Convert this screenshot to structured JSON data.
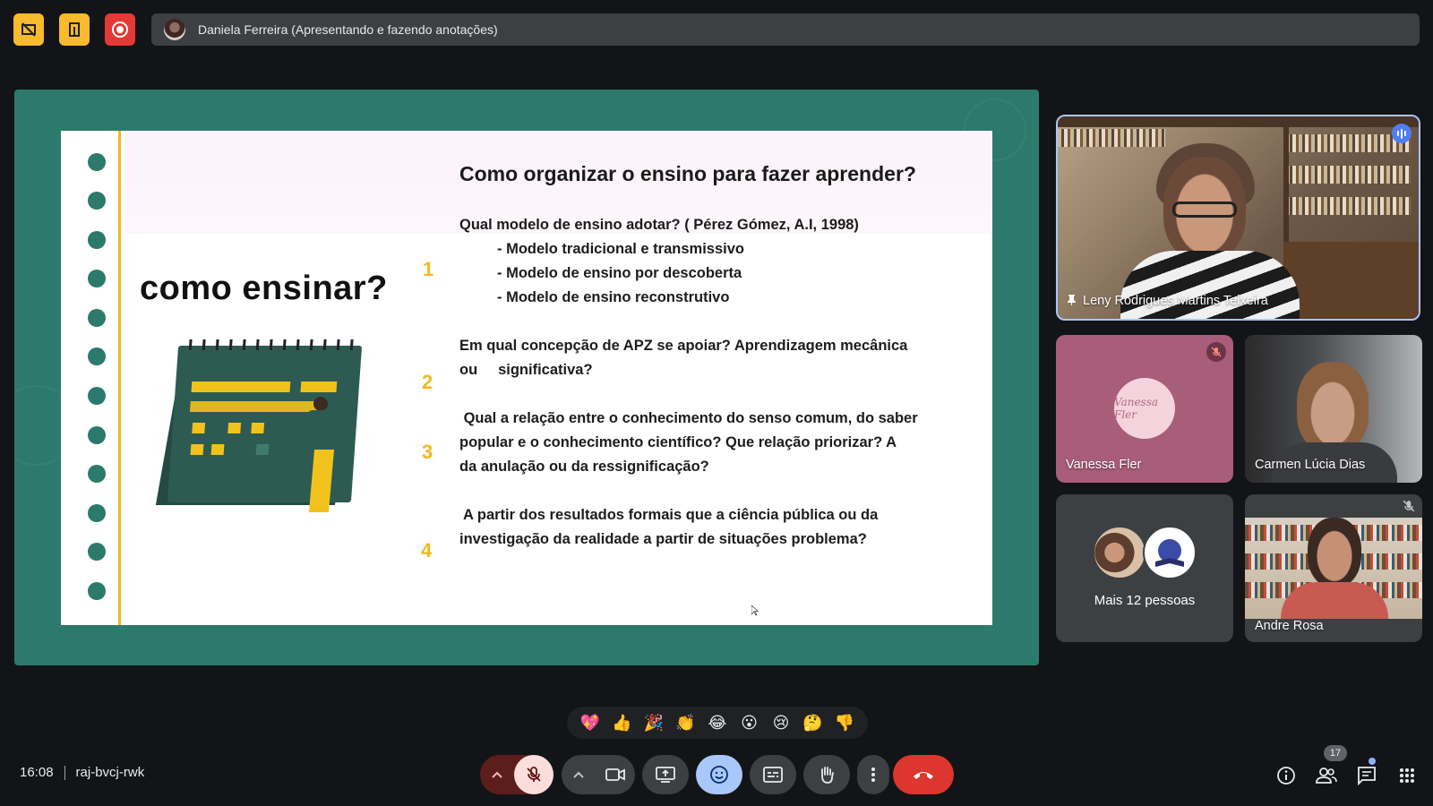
{
  "presenter": {
    "label": "Daniela Ferreira (Apresentando e fazendo anotações)"
  },
  "slide": {
    "title": "Como organizar o ensino para fazer aprender?",
    "heading": "como ensinar?",
    "q1": "Qual modelo de ensino adotar? ( Pérez Gómez, A.I, 1998)",
    "q1_items": [
      "- Modelo tradicional e transmissivo",
      "- Modelo de ensino por descoberta",
      "- Modelo de ensino reconstrutivo"
    ],
    "q2_line1": "Em qual concepção de APZ se apoiar? Aprendizagem mecânica",
    "q2_line2": "ou     significativa?",
    "q3_line1": " Qual a relação entre o conhecimento do senso comum, do saber",
    "q3_line2": "popular e o conhecimento científico? Que relação priorizar? A",
    "q3_line3": "da anulação ou da ressignificação?",
    "q4_line1": " A partir dos resultados formais que a ciência pública ou da",
    "q4_line2": "investigação da realidade a partir de situações problema?",
    "numbers": [
      "1",
      "2",
      "3",
      "4"
    ]
  },
  "participants": {
    "main": "Leny Rodrigues Martins Teixeira",
    "vanessa": "Vanessa Fler",
    "vanessa_logo": "Vanessa Fler",
    "carmen": "Carmen Lúcia Dias",
    "more": "Mais 12 pessoas",
    "andre": "Andre Rosa"
  },
  "reactions": [
    "💖",
    "👍",
    "🎉",
    "👏",
    "😂",
    "😮",
    "😢",
    "🤔",
    "👎"
  ],
  "meeting": {
    "time": "16:08",
    "code": "raj-bvcj-rwk",
    "people_count": "17"
  },
  "colors": {
    "accent_yellow": "#f9bb2d",
    "record_red": "#e53935",
    "end_call_red": "#dc362e",
    "active_blue": "#a8c7fa",
    "slide_bg": "#2c7a6b"
  }
}
